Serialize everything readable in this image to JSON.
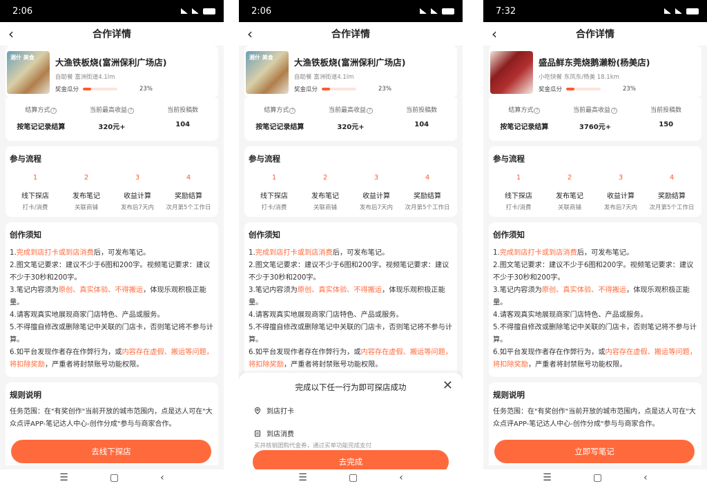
{
  "phones": [
    {
      "time": "2:06",
      "nav_title": "合作详情",
      "shop": {
        "name": "大渔铁板烧(富洲保利广场店)",
        "meta": "自助餐 富洲街道4.1lm",
        "bonus_label": "奖金瓜分",
        "bonus_pct": "23%",
        "bonus_value": 0.23,
        "thumb_text": "湘什 美食"
      },
      "stats": [
        {
          "label": "结算方式",
          "value": "按笔记记录结算"
        },
        {
          "label": "当前最高收益",
          "value": "320元+"
        },
        {
          "label": "当前投稿数",
          "value": "104"
        }
      ],
      "flow_title": "参与流程",
      "steps": [
        {
          "num": "1",
          "name": "线下探店",
          "desc": "打卡/消费"
        },
        {
          "num": "2",
          "name": "发布笔记",
          "desc": "关联商铺"
        },
        {
          "num": "3",
          "name": "收益计算",
          "desc": "发布后7天内"
        },
        {
          "num": "4",
          "name": "奖励结算",
          "desc": "次月第5个工作日"
        }
      ],
      "notice_title": "创作须知",
      "rule_title": "规则说明",
      "rule_text": "任务范围：在\"有奖创作\"当前开放的城市范围内，点是达人可在\"大众点评APP-笔记达人中心-创作分成\"参与与商家合作。",
      "cta": "去线下探店"
    },
    {
      "time": "2:06",
      "nav_title": "合作详情",
      "shop": {
        "name": "大渔铁板烧(富洲保利广场店)",
        "meta": "自助餐 富洲街道4.1lm",
        "bonus_label": "奖金瓜分",
        "bonus_pct": "23%",
        "bonus_value": 0.23,
        "thumb_text": "湘什 美食"
      },
      "stats": [
        {
          "label": "结算方式",
          "value": "按笔记记录结算"
        },
        {
          "label": "当前最高收益",
          "value": "320元+"
        },
        {
          "label": "当前投稿数",
          "value": "104"
        }
      ],
      "flow_title": "参与流程",
      "steps": [
        {
          "num": "1",
          "name": "线下探店",
          "desc": "打卡/消费"
        },
        {
          "num": "2",
          "name": "发布笔记",
          "desc": "关联商铺"
        },
        {
          "num": "3",
          "name": "收益计算",
          "desc": "发布后7天内"
        },
        {
          "num": "4",
          "name": "奖励结算",
          "desc": "次月第5个工作日"
        }
      ],
      "notice_title": "创作须知",
      "sheet": {
        "title": "完成以下任一行为即可探店成功",
        "opt1": "到店打卡",
        "opt2": "到店消费",
        "opt2_desc": "买并核销团购代金券，通过买单功能完成支付"
      },
      "cta": "去完成"
    },
    {
      "time": "7:32",
      "nav_title": "合作详情",
      "shop": {
        "name": "盛品鲜东莞烧鹅濑粉(杨美店)",
        "meta": "小吃快餐 东凤东/杨美 18.1km",
        "bonus_label": "奖金瓜分",
        "bonus_pct": "23%",
        "bonus_value": 0.23,
        "thumb_text": ""
      },
      "stats": [
        {
          "label": "结算方式",
          "value": "按笔记记录结算"
        },
        {
          "label": "当前最高收益",
          "value": "3760元+"
        },
        {
          "label": "当前投稿数",
          "value": "150"
        }
      ],
      "flow_title": "参与流程",
      "steps": [
        {
          "num": "1",
          "name": "线下探店",
          "desc": "打卡/消费"
        },
        {
          "num": "2",
          "name": "发布笔记",
          "desc": "关联商铺"
        },
        {
          "num": "3",
          "name": "收益计算",
          "desc": "发布后7天内"
        },
        {
          "num": "4",
          "name": "奖励结算",
          "desc": "次月第5个工作日"
        }
      ],
      "notice_title": "创作须知",
      "rule_title": "规则说明",
      "rule_text": "任务范围：在\"有奖创作\"当前开放的城市范围内，点是达人可在\"大众点评APP-笔记达人中心-创作分成\"参与与商家合作。",
      "cta": "立即写笔记"
    }
  ],
  "notice": {
    "r1_a": "1.",
    "r1_hl": "完成到店打卡或到店消费",
    "r1_b": "后，可发布笔记。",
    "r2": "2.图文笔记要求：建议不少于6图和200字。视频笔记要求：建议不少于30秒和200字。",
    "r3_a": "3.笔记内容须为",
    "r3_hl": "原创、真实体验、不得搬运",
    "r3_b": "，体现乐观积极正能量。",
    "r4": "4.请客观真实地展现商家门店特色、产品或服务。",
    "r5": "5.不得擅自修改或删除笔记中关联的门店卡，否则笔记将不参与计算。",
    "r6_a": "6.如平台发现作者存在作弊行为，或",
    "r6_hl": "内容存在虚假、搬运等问题，将扣除奖励",
    "r6_b": "，严重者将封禁账号功能权限。"
  },
  "colors": {
    "accent": "#ff6a3d",
    "progress": "#ff5a2b"
  }
}
